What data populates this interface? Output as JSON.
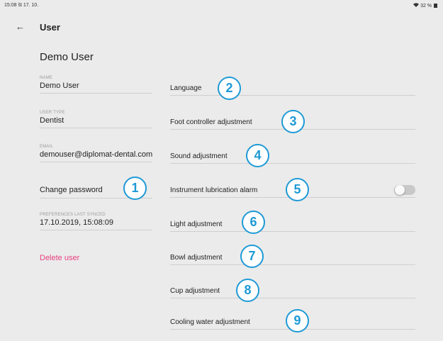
{
  "status_bar": {
    "time_date": "15:08  št 17. 10.",
    "battery": "32 %"
  },
  "header": {
    "back_icon": "←",
    "title": "User"
  },
  "profile": {
    "display_name": "Demo User",
    "name_label": "NAME",
    "name_value": "Demo User",
    "user_type_label": "USER TYPE",
    "user_type_value": "Dentist",
    "email_label": "EMAIL",
    "email_value": "demouser@diplomat-dental.com",
    "change_password": "Change password",
    "synced_label": "PREFERENCES LAST SYNCED",
    "synced_value": "17.10.2019, 15:08:09",
    "delete_user": "Delete user"
  },
  "settings": [
    {
      "label": "Language",
      "badge": "2"
    },
    {
      "label": "Foot controller adjustment",
      "badge": "3"
    },
    {
      "label": "Sound adjustment",
      "badge": "4"
    },
    {
      "label": "Instrument lubrication alarm",
      "badge": "5",
      "toggle": "off"
    },
    {
      "label": "Light adjustment",
      "badge": "6"
    },
    {
      "label": "Bowl adjustment",
      "badge": "7"
    },
    {
      "label": "Cup adjustment",
      "badge": "8"
    },
    {
      "label": "Cooling water adjustment",
      "badge": "9"
    }
  ],
  "change_password_badge": "1",
  "colors": {
    "accent_badge": "#1e9ad6",
    "delete": "#e8417e",
    "background": "#ebebeb"
  }
}
